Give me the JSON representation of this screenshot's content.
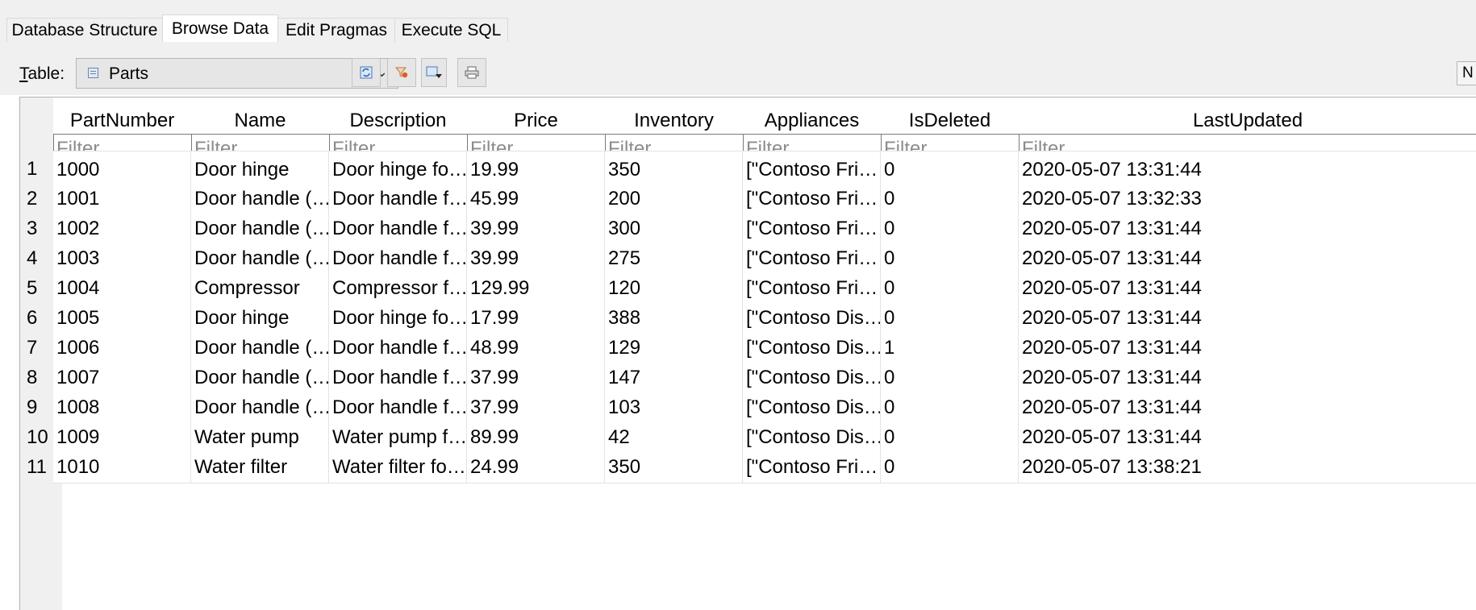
{
  "tabs": [
    {
      "label": "Database Structure"
    },
    {
      "label": "Browse Data"
    },
    {
      "label": "Edit Pragmas"
    },
    {
      "label": "Execute SQL"
    }
  ],
  "toolbar": {
    "table_label": "Table:",
    "table_label_underlined": "T",
    "table_label_rest": "able:",
    "selected_table": "Parts",
    "icons": [
      "refresh-icon",
      "clear-filters-icon",
      "save-table-icon",
      "print-icon"
    ],
    "new_record_partial": "N"
  },
  "grid": {
    "columns": [
      "PartNumber",
      "Name",
      "Description",
      "Price",
      "Inventory",
      "Appliances",
      "IsDeleted",
      "LastUpdated"
    ],
    "filter_placeholder": "Filter",
    "rows": [
      {
        "num": "1",
        "cells": [
          "1000",
          "Door hinge",
          "Door hinge fo…",
          "19.99",
          "350",
          "[\"Contoso Fri…",
          "0",
          "2020-05-07 13:31:44"
        ]
      },
      {
        "num": "2",
        "cells": [
          "1001",
          "Door handle (…",
          "Door handle f…",
          "45.99",
          "200",
          "[\"Contoso Fri…",
          "0",
          "2020-05-07 13:32:33"
        ]
      },
      {
        "num": "3",
        "cells": [
          "1002",
          "Door handle (…",
          "Door handle f…",
          "39.99",
          "300",
          "[\"Contoso Fri…",
          "0",
          "2020-05-07 13:31:44"
        ]
      },
      {
        "num": "4",
        "cells": [
          "1003",
          "Door handle (…",
          "Door handle f…",
          "39.99",
          "275",
          "[\"Contoso Fri…",
          "0",
          "2020-05-07 13:31:44"
        ]
      },
      {
        "num": "5",
        "cells": [
          "1004",
          "Compressor",
          "Compressor f…",
          "129.99",
          "120",
          "[\"Contoso Fri…",
          "0",
          "2020-05-07 13:31:44"
        ]
      },
      {
        "num": "6",
        "cells": [
          "1005",
          "Door hinge",
          "Door hinge fo…",
          "17.99",
          "388",
          "[\"Contoso Dis…",
          "0",
          "2020-05-07 13:31:44"
        ]
      },
      {
        "num": "7",
        "cells": [
          "1006",
          "Door handle (…",
          "Door handle f…",
          "48.99",
          "129",
          "[\"Contoso Dis…",
          "1",
          "2020-05-07 13:31:44"
        ]
      },
      {
        "num": "8",
        "cells": [
          "1007",
          "Door handle (…",
          "Door handle f…",
          "37.99",
          "147",
          "[\"Contoso Dis…",
          "0",
          "2020-05-07 13:31:44"
        ]
      },
      {
        "num": "9",
        "cells": [
          "1008",
          "Door handle (…",
          "Door handle f…",
          "37.99",
          "103",
          "[\"Contoso Dis…",
          "0",
          "2020-05-07 13:31:44"
        ]
      },
      {
        "num": "10",
        "cells": [
          "1009",
          "Water pump",
          "Water pump f…",
          "89.99",
          "42",
          "[\"Contoso Dis…",
          "0",
          "2020-05-07 13:31:44"
        ]
      },
      {
        "num": "11",
        "cells": [
          "1010",
          "Water filter",
          "Water filter fo…",
          "24.99",
          "350",
          "[\"Contoso Fri…",
          "0",
          "2020-05-07 13:38:21"
        ]
      }
    ]
  }
}
